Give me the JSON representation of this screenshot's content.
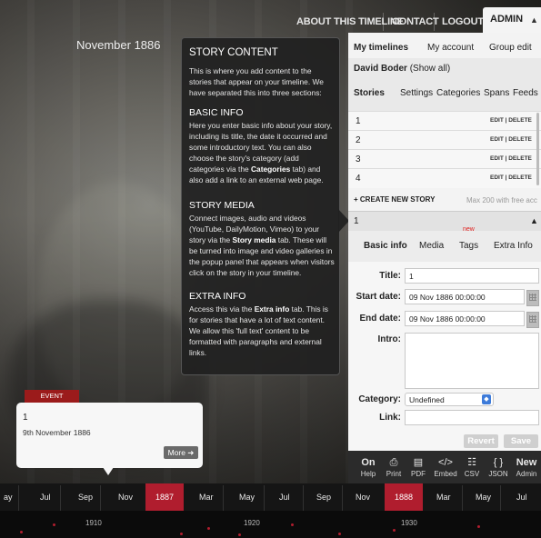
{
  "nav": {
    "about": "ABOUT THIS TIMELINE",
    "contact": "CONTACT",
    "logout": "LOGOUT",
    "admin": "ADMIN",
    "admin_arrow": "▲"
  },
  "story_date_label": "November 1886",
  "help": {
    "title": "STORY CONTENT",
    "intro": "This is where you add content to the stories that appear on your timeline. We have separated this into three sections:",
    "basic_title": "BASIC INFO",
    "basic_text_1": "Here you enter basic info about your story, including its title, the date it occurred and some introductory text. You can also choose the story's category (add categories via the ",
    "basic_text_bold": "Categories",
    "basic_text_2": " tab) and also add a link to an external web page.",
    "media_title": "STORY MEDIA",
    "media_text_1": "Connect images, audio and videos (YouTube, DailyMotion, Vimeo) to your story via the ",
    "media_text_bold": "Story media",
    "media_text_2": " tab. These will be turned into image and video galleries in the popup panel that appears when visitors click on the story in your timeline.",
    "extra_title": "EXTRA INFO",
    "extra_text_1": "Access this via the ",
    "extra_text_bold": "Extra info",
    "extra_text_2": " tab. This is for stories that have a lot of text content. We allow this 'full text' content to be formatted with paragraphs and external links."
  },
  "panel": {
    "top_tabs": [
      "My timelines",
      "My account",
      "Group edit"
    ],
    "user_name": "David Boder",
    "show_all": "(Show all)",
    "sub_tabs": [
      "Stories",
      "Settings",
      "Categories",
      "Spans",
      "Feeds"
    ],
    "stories": [
      {
        "num": "1",
        "actions": "EDIT | DELETE"
      },
      {
        "num": "2",
        "actions": "EDIT | DELETE"
      },
      {
        "num": "3",
        "actions": "EDIT | DELETE"
      },
      {
        "num": "4",
        "actions": "EDIT | DELETE"
      }
    ],
    "create_label": "+ CREATE NEW STORY",
    "create_limit": "Max 200 with free acc",
    "selected_story": "1",
    "selected_arrow": "▲",
    "edit_tabs": [
      "Basic info",
      "Media",
      "Tags",
      "Extra Info"
    ],
    "new_badge": "new",
    "form": {
      "title_label": "Title:",
      "title_value": "1",
      "start_label": "Start date:",
      "start_value": "09 Nov 1886 00:00:00",
      "end_label": "End date:",
      "end_value": "09 Nov 1886 00:00:00",
      "intro_label": "Intro:",
      "intro_value": "",
      "category_label": "Category:",
      "category_value": "Undefined",
      "link_label": "Link:",
      "link_value": ""
    },
    "revert": "Revert",
    "save": "Save"
  },
  "toolbar": [
    {
      "icon": "On",
      "label": "Help",
      "name": "help"
    },
    {
      "icon": "⎙",
      "label": "Print",
      "name": "print"
    },
    {
      "icon": "▤",
      "label": "PDF",
      "name": "pdf"
    },
    {
      "icon": "</>",
      "label": "Embed",
      "name": "embed"
    },
    {
      "icon": "☷",
      "label": "CSV",
      "name": "csv"
    },
    {
      "icon": "{ }",
      "label": "JSON",
      "name": "json"
    },
    {
      "icon": "New",
      "label": "Admin",
      "name": "admin"
    }
  ],
  "event": {
    "tag": "EVENT",
    "title": "1",
    "date": "9th November 1886",
    "more": "More ➜"
  },
  "timeline": {
    "months": [
      "ay",
      "Jul",
      "Sep",
      "Nov",
      "1887",
      "Mar",
      "May",
      "Jul",
      "Sep",
      "Nov",
      "1888",
      "Mar",
      "May",
      "Jul"
    ],
    "decades": [
      "1910",
      "1920",
      "1930"
    ]
  },
  "colors": {
    "accent_red": "#b01d2e",
    "event_red": "#9b1b1b",
    "panel_bg": "#f3f3f3",
    "new_badge": "#e0201e"
  }
}
